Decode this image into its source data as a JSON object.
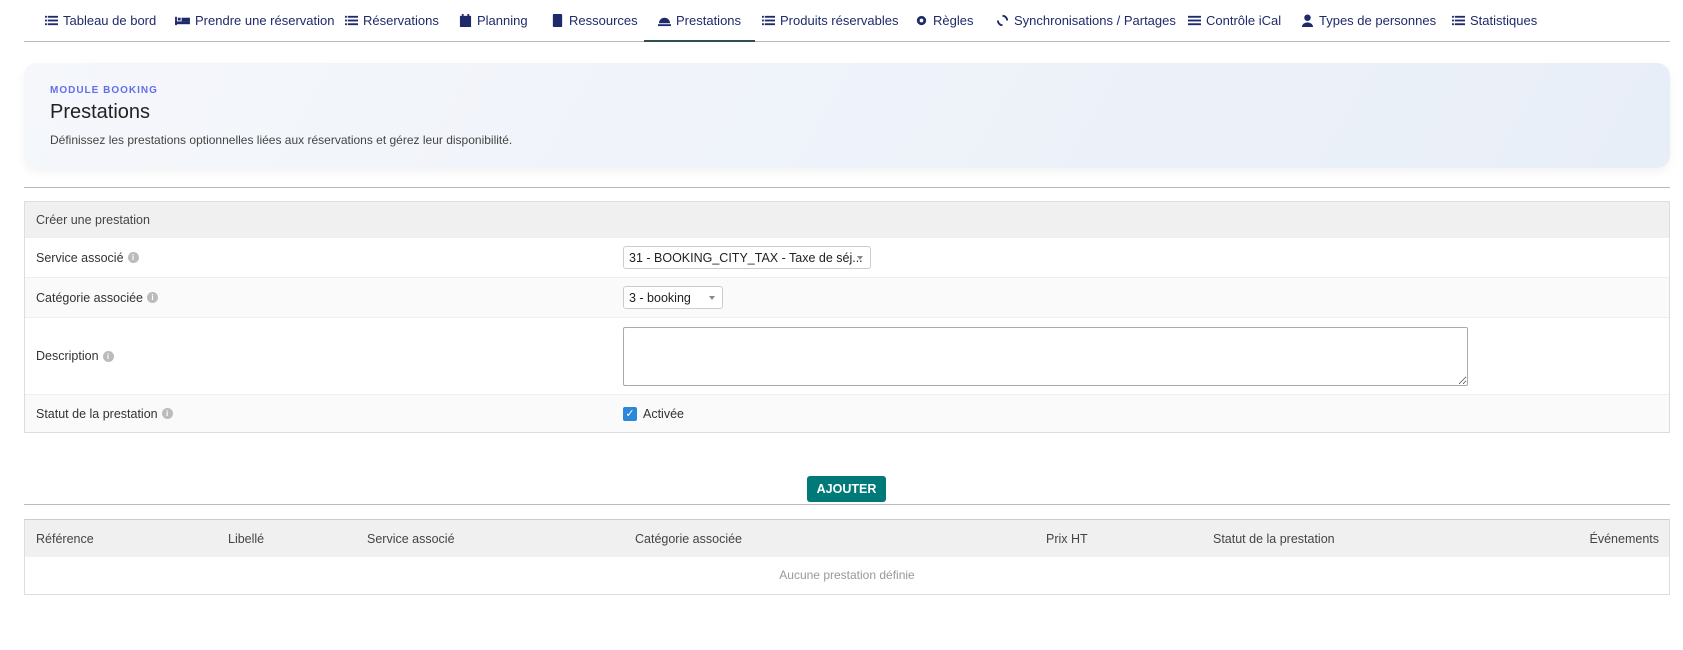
{
  "tabs": [
    {
      "label": "Tableau de bord",
      "icon": "list-icon"
    },
    {
      "label": "Prendre une réservation",
      "icon": "bed-icon"
    },
    {
      "label": "Réservations",
      "icon": "list-icon"
    },
    {
      "label": "Planning",
      "icon": "calendar-icon"
    },
    {
      "label": "Ressources",
      "icon": "book-icon"
    },
    {
      "label": "Prestations",
      "icon": "bell-icon",
      "active": true
    },
    {
      "label": "Produits réservables",
      "icon": "list-icon"
    },
    {
      "label": "Règles",
      "icon": "gear-icon"
    },
    {
      "label": "Synchronisations / Partages",
      "icon": "sync-icon"
    },
    {
      "label": "Contrôle iCal",
      "icon": "sliders-icon"
    },
    {
      "label": "Types de personnes",
      "icon": "user-icon"
    },
    {
      "label": "Statistiques",
      "icon": "list-icon"
    }
  ],
  "hero": {
    "eyebrow": "MODULE BOOKING",
    "title": "Prestations",
    "description": "Définissez les prestations optionnelles liées aux réservations et gérez leur disponibilité."
  },
  "form": {
    "title": "Créer une prestation",
    "service_label": "Service associé",
    "service_value": "31 - BOOKING_CITY_TAX - Taxe de séj...",
    "category_label": "Catégorie associée",
    "category_value": "3 - booking",
    "description_label": "Description",
    "description_value": "",
    "status_label": "Statut de la prestation",
    "status_checkbox_label": "Activée",
    "status_checked": true,
    "info_glyph": "i"
  },
  "add_button": "AJOUTER",
  "table": {
    "columns": [
      "Référence",
      "Libellé",
      "Service associé",
      "Catégorie associée",
      "Prix HT",
      "Statut de la prestation",
      "Événements"
    ],
    "empty": "Aucune prestation définie"
  }
}
